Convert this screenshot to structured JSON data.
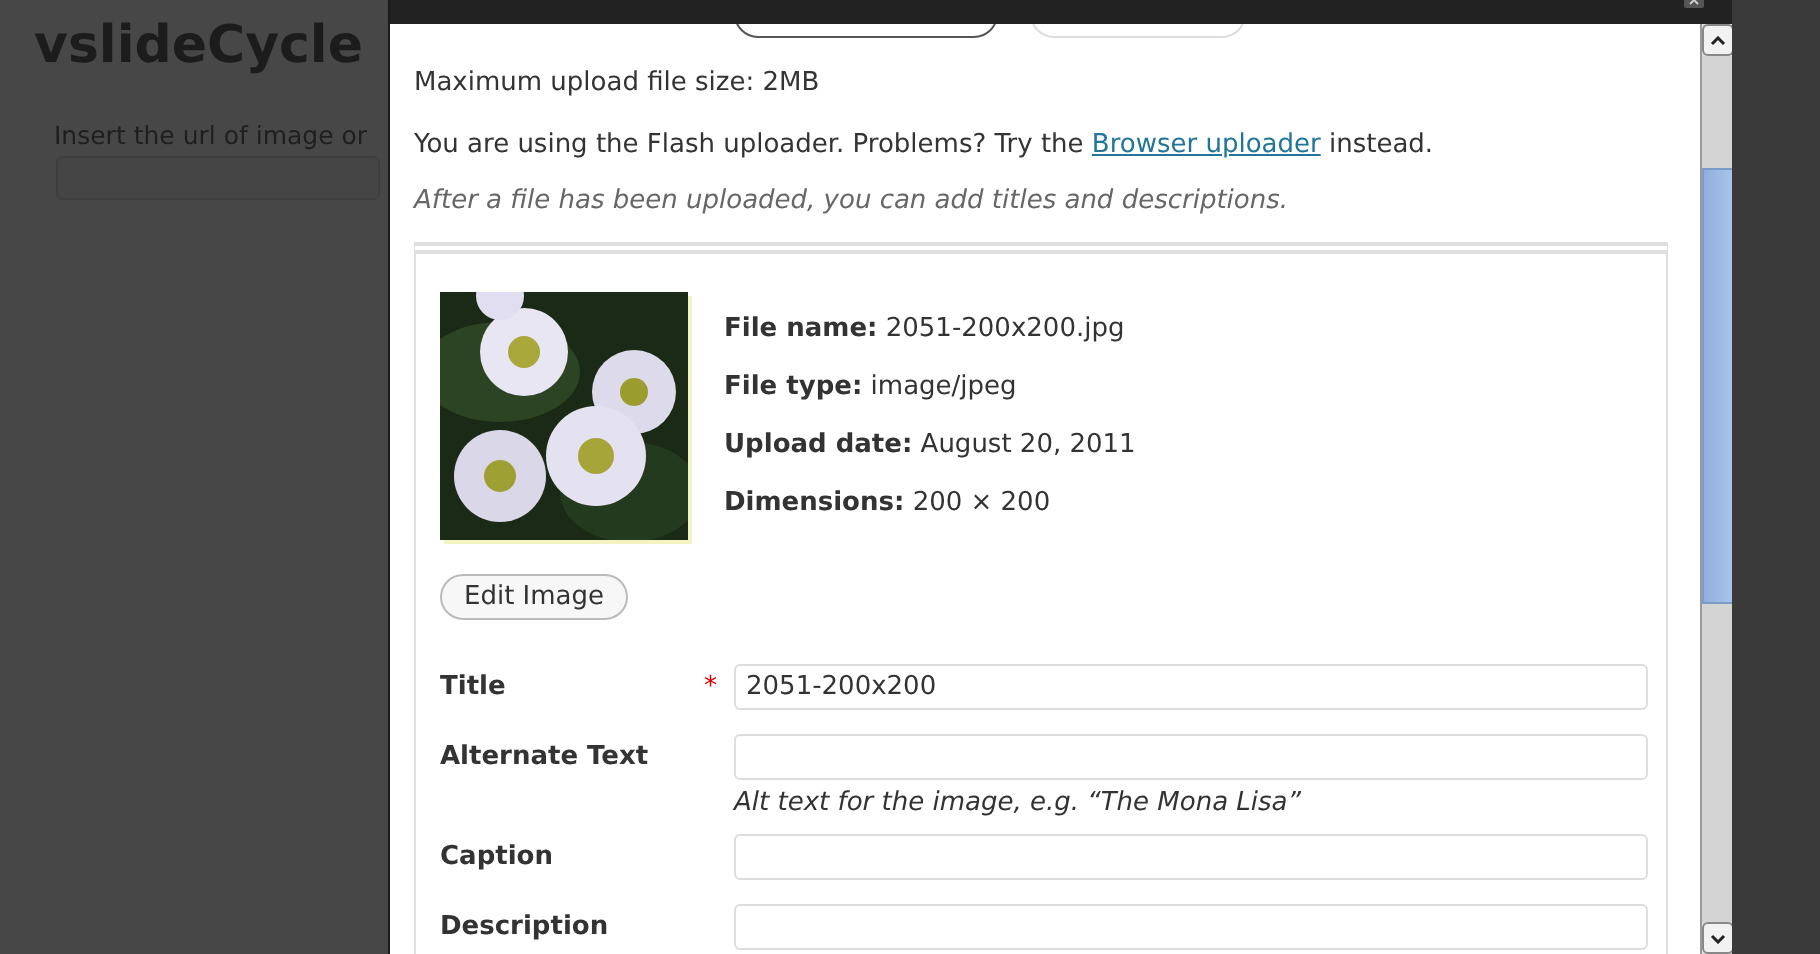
{
  "background_page": {
    "title": "vslideCycle",
    "prompt": "Insert the url of image or"
  },
  "upload_info": {
    "max_size": "Maximum upload file size: 2MB",
    "flash_text": "You are using the Flash uploader. Problems? Try the",
    "flash_link": "Browser uploader",
    "flash_after": "instead.",
    "note": "After a file has been uploaded, you can add titles and descriptions."
  },
  "attachment": {
    "details": [
      {
        "label": "File name:",
        "value": "2051-200x200.jpg"
      },
      {
        "label": "File type:",
        "value": "image/jpeg"
      },
      {
        "label": "Upload date:",
        "value": "August 20, 2011"
      },
      {
        "label": "Dimensions:",
        "value": "200 × 200"
      }
    ],
    "edit_button": "Edit Image"
  },
  "fields": [
    {
      "label": "Title",
      "required_mark": "*",
      "value": "2051-200x200"
    },
    {
      "label": "Alternate Text",
      "help": "Alt text for the image, e.g. “The Mona Lisa”"
    },
    {
      "label": "Caption"
    },
    {
      "label": "Description"
    }
  ]
}
